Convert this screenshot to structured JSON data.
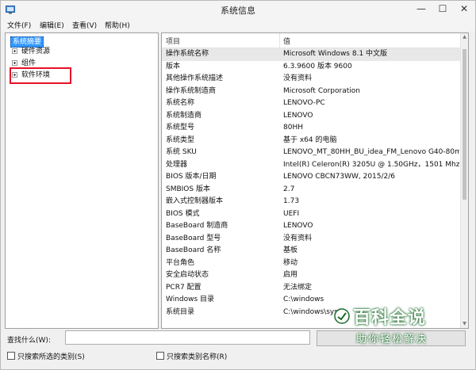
{
  "window": {
    "title": "系统信息"
  },
  "window_controls": {
    "minimize": "—",
    "maximize": "☐",
    "close": "✕"
  },
  "menu": [
    "文件(F)",
    "编辑(E)",
    "查看(V)",
    "帮助(H)"
  ],
  "tree": {
    "root": "系统摘要",
    "children": [
      "硬件资源",
      "组件",
      "软件环境"
    ]
  },
  "list": {
    "columns": {
      "item": "项目",
      "value": "值"
    },
    "rows": [
      {
        "item": "操作系统名称",
        "value": "Microsoft Windows 8.1 中文版"
      },
      {
        "item": "版本",
        "value": "6.3.9600 版本 9600"
      },
      {
        "item": "其他操作系统描述",
        "value": "没有资料"
      },
      {
        "item": "操作系统制造商",
        "value": "Microsoft Corporation"
      },
      {
        "item": "系统名称",
        "value": "LENOVO-PC"
      },
      {
        "item": "系统制造商",
        "value": "LENOVO"
      },
      {
        "item": "系统型号",
        "value": "80HH"
      },
      {
        "item": "系统类型",
        "value": "基于 x64 的电脑"
      },
      {
        "item": "系统 SKU",
        "value": "LENOVO_MT_80HH_BU_idea_FM_Lenovo G40-80m"
      },
      {
        "item": "处理器",
        "value": "Intel(R) Celeron(R) 3205U @ 1.50GHz，1501 Mhz，"
      },
      {
        "item": "BIOS 版本/日期",
        "value": "LENOVO CBCN73WW, 2015/2/6"
      },
      {
        "item": "SMBIOS 版本",
        "value": "2.7"
      },
      {
        "item": "嵌入式控制器版本",
        "value": "1.73"
      },
      {
        "item": "BIOS 模式",
        "value": "UEFI"
      },
      {
        "item": "BaseBoard 制造商",
        "value": "LENOVO"
      },
      {
        "item": "BaseBoard 型号",
        "value": "没有资料"
      },
      {
        "item": "BaseBoard 名称",
        "value": "基板"
      },
      {
        "item": "平台角色",
        "value": "移动"
      },
      {
        "item": "安全启动状态",
        "value": "启用"
      },
      {
        "item": "PCR7 配置",
        "value": "无法绑定"
      },
      {
        "item": "Windows 目录",
        "value": "C:\\windows"
      },
      {
        "item": "系统目录",
        "value": "C:\\windows\\syst"
      }
    ]
  },
  "find": {
    "label": "查找什么(W):",
    "value": "",
    "only_selected_category": "只搜索所选的类别(S)",
    "only_category_names": "只搜索类别名称(R)"
  },
  "watermark": {
    "brand": "百科全说",
    "tagline": "助你轻松解决"
  },
  "colors": {
    "selection": "#3399ff",
    "highlight_box": "#e8102a",
    "watermark_outline": "#1a6b2a"
  }
}
